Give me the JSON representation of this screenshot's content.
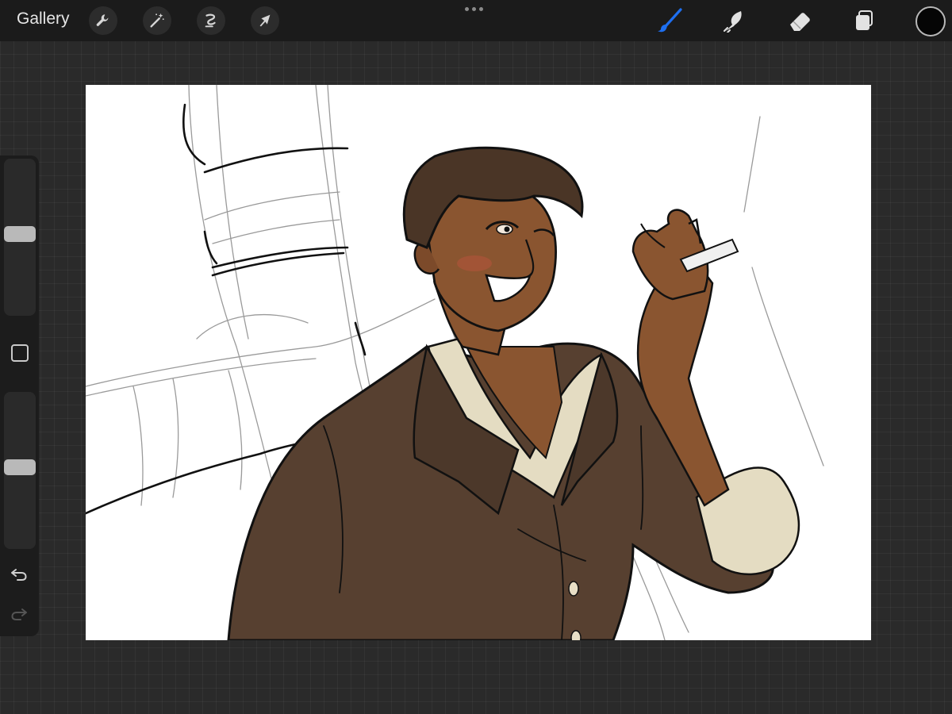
{
  "topbar": {
    "gallery_label": "Gallery",
    "left_tools": [
      "wrench-icon",
      "magic-wand-icon",
      "selection-icon",
      "transform-arrow-icon"
    ],
    "right_tools": [
      "brush-icon",
      "smudge-icon",
      "eraser-icon",
      "layers-icon"
    ],
    "active_tool": "brush-icon",
    "accent_color": "#1e6ff0",
    "current_color": "#050505"
  },
  "sidebar": {
    "brush_size_level": 0.52,
    "opacity_level": 0.52,
    "modify_button_icon": "square-icon",
    "undo_icon": "undo-icon",
    "redo_icon": "redo-icon"
  },
  "canvas": {
    "background": "#ffffff",
    "content": "artwork"
  }
}
